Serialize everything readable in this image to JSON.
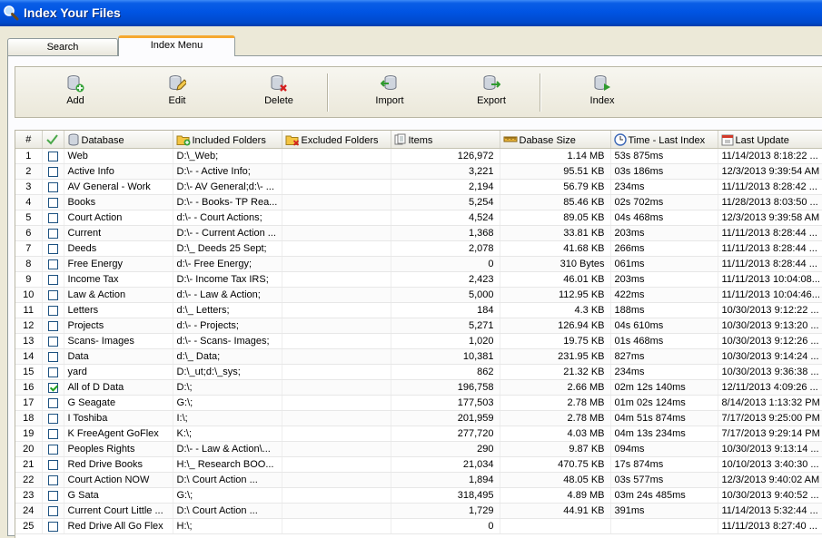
{
  "window": {
    "title": "Index Your Files"
  },
  "tabs": [
    {
      "label": "Search",
      "active": false
    },
    {
      "label": "Index Menu",
      "active": true
    }
  ],
  "toolbar": {
    "add_label": "Add",
    "edit_label": "Edit",
    "delete_label": "Delete",
    "import_label": "Import",
    "export_label": "Export",
    "index_label": "Index"
  },
  "columns": {
    "num": "#",
    "database": "Database",
    "included": "Included Folders",
    "excluded": "Excluded Folders",
    "items": "Items",
    "size": "Dabase Size",
    "time": "Time - Last Index",
    "update": "Last Update"
  },
  "rows": [
    {
      "n": "1",
      "checked": false,
      "db": "Web",
      "inc": "D:\\_Web;",
      "exc": "",
      "items": "126,972",
      "size": "1.14 MB",
      "time": "53s 875ms",
      "update": "11/14/2013 8:18:22 ..."
    },
    {
      "n": "2",
      "checked": false,
      "db": "Active Info",
      "inc": "D:\\- - Active Info;",
      "exc": "",
      "items": "3,221",
      "size": "95.51 KB",
      "time": "03s 186ms",
      "update": "12/3/2013 9:39:54 AM"
    },
    {
      "n": "3",
      "checked": false,
      "db": "AV General - Work",
      "inc": "D:\\- AV General;d:\\- ...",
      "exc": "",
      "items": "2,194",
      "size": "56.79 KB",
      "time": "234ms",
      "update": "11/11/2013 8:28:42 ..."
    },
    {
      "n": "4",
      "checked": false,
      "db": "Books",
      "inc": "D:\\- - Books- TP Rea...",
      "exc": "",
      "items": "5,254",
      "size": "85.46 KB",
      "time": "02s 702ms",
      "update": "11/28/2013 8:03:50 ..."
    },
    {
      "n": "5",
      "checked": false,
      "db": "Court Action",
      "inc": "d:\\- - Court Actions;",
      "exc": "",
      "items": "4,524",
      "size": "89.05 KB",
      "time": "04s 468ms",
      "update": "12/3/2013 9:39:58 AM"
    },
    {
      "n": "6",
      "checked": false,
      "db": "Current",
      "inc": "D:\\- - Current Action ...",
      "exc": "",
      "items": "1,368",
      "size": "33.81 KB",
      "time": "203ms",
      "update": "11/11/2013 8:28:44 ..."
    },
    {
      "n": "7",
      "checked": false,
      "db": "Deeds",
      "inc": "D:\\_ Deeds 25 Sept;",
      "exc": "",
      "items": "2,078",
      "size": "41.68 KB",
      "time": "266ms",
      "update": "11/11/2013 8:28:44 ..."
    },
    {
      "n": "8",
      "checked": false,
      "db": "Free Energy",
      "inc": "d:\\- Free Energy;",
      "exc": "",
      "items": "0",
      "size": "310 Bytes",
      "time": "061ms",
      "update": "11/11/2013 8:28:44 ..."
    },
    {
      "n": "9",
      "checked": false,
      "db": "Income Tax",
      "inc": "D:\\- Income Tax IRS;",
      "exc": "",
      "items": "2,423",
      "size": "46.01 KB",
      "time": "203ms",
      "update": "11/11/2013 10:04:08..."
    },
    {
      "n": "10",
      "checked": false,
      "db": "Law & Action",
      "inc": "d:\\- - Law & Action;",
      "exc": "",
      "items": "5,000",
      "size": "112.95 KB",
      "time": "422ms",
      "update": "11/11/2013 10:04:46..."
    },
    {
      "n": "11",
      "checked": false,
      "db": "Letters",
      "inc": "d:\\_ Letters;",
      "exc": "",
      "items": "184",
      "size": "4.3 KB",
      "time": "188ms",
      "update": "10/30/2013 9:12:22 ..."
    },
    {
      "n": "12",
      "checked": false,
      "db": "Projects",
      "inc": "d:\\- - Projects;",
      "exc": "",
      "items": "5,271",
      "size": "126.94 KB",
      "time": "04s 610ms",
      "update": "10/30/2013 9:13:20 ..."
    },
    {
      "n": "13",
      "checked": false,
      "db": "Scans- Images",
      "inc": "d:\\- - Scans- Images;",
      "exc": "",
      "items": "1,020",
      "size": "19.75 KB",
      "time": "01s 468ms",
      "update": "10/30/2013 9:12:26 ..."
    },
    {
      "n": "14",
      "checked": false,
      "db": "Data",
      "inc": "d:\\_ Data;",
      "exc": "",
      "items": "10,381",
      "size": "231.95 KB",
      "time": "827ms",
      "update": "10/30/2013 9:14:24 ..."
    },
    {
      "n": "15",
      "checked": false,
      "db": "yard",
      "inc": "D:\\_ut;d:\\_sys;",
      "exc": "",
      "items": "862",
      "size": "21.32 KB",
      "time": "234ms",
      "update": "10/30/2013 9:36:38 ..."
    },
    {
      "n": "16",
      "checked": true,
      "db": "All of D Data",
      "inc": "D:\\;",
      "exc": "",
      "items": "196,758",
      "size": "2.66 MB",
      "time": "02m 12s 140ms",
      "update": "12/11/2013 4:09:26 ..."
    },
    {
      "n": "17",
      "checked": false,
      "db": "G Seagate",
      "inc": "G:\\;",
      "exc": "",
      "items": "177,503",
      "size": "2.78 MB",
      "time": "01m 02s 124ms",
      "update": "8/14/2013 1:13:32 PM"
    },
    {
      "n": "18",
      "checked": false,
      "db": "I Toshiba",
      "inc": "I:\\;",
      "exc": "",
      "items": "201,959",
      "size": "2.78 MB",
      "time": "04m 51s 874ms",
      "update": "7/17/2013 9:25:00 PM"
    },
    {
      "n": "19",
      "checked": false,
      "db": "K FreeAgent GoFlex",
      "inc": "K:\\;",
      "exc": "",
      "items": "277,720",
      "size": "4.03 MB",
      "time": "04m 13s 234ms",
      "update": "7/17/2013 9:29:14 PM"
    },
    {
      "n": "20",
      "checked": false,
      "db": "Peoples Rights",
      "inc": "D:\\- - Law & Action\\...",
      "exc": "",
      "items": "290",
      "size": "9.87 KB",
      "time": "094ms",
      "update": "10/30/2013 9:13:14 ..."
    },
    {
      "n": "21",
      "checked": false,
      "db": "Red Drive Books",
      "inc": "H:\\_ Research BOO...",
      "exc": "",
      "items": "21,034",
      "size": "470.75 KB",
      "time": "17s 874ms",
      "update": "10/10/2013 3:40:30 ..."
    },
    {
      "n": "22",
      "checked": false,
      "db": "Court Action NOW",
      "inc": "D:\\      Court Action ...",
      "exc": "",
      "items": "1,894",
      "size": "48.05 KB",
      "time": "03s 577ms",
      "update": "12/3/2013 9:40:02 AM"
    },
    {
      "n": "23",
      "checked": false,
      "db": "G Sata",
      "inc": "G:\\;",
      "exc": "",
      "items": "318,495",
      "size": "4.89 MB",
      "time": "03m 24s 485ms",
      "update": "10/30/2013 9:40:52 ..."
    },
    {
      "n": "24",
      "checked": false,
      "db": "Current Court Little ...",
      "inc": "D:\\      Court Action ...",
      "exc": "",
      "items": "1,729",
      "size": "44.91 KB",
      "time": "391ms",
      "update": "11/14/2013 5:32:44 ..."
    },
    {
      "n": "25",
      "checked": false,
      "db": "Red Drive All Go Flex",
      "inc": "H:\\;",
      "exc": "",
      "items": "0",
      "size": "",
      "time": "",
      "update": "11/11/2013 8:27:40 ..."
    }
  ]
}
